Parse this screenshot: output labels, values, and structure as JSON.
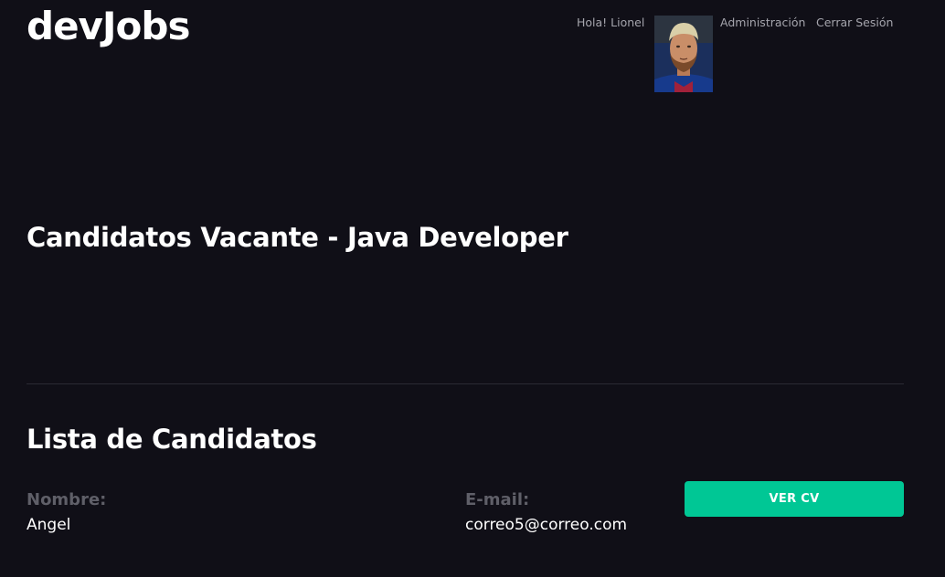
{
  "header": {
    "logo": "devJobs",
    "greeting": "Hola! Lionel",
    "admin_link": "Administración",
    "logout_link": "Cerrar Sesión"
  },
  "page": {
    "title": "Candidatos Vacante - Java Developer"
  },
  "candidates_section": {
    "title": "Lista de Candidatos",
    "name_label": "Nombre:",
    "email_label": "E-mail:",
    "items": [
      {
        "name": "Angel",
        "email": "correo5@correo.com",
        "button_label": "VER CV"
      }
    ]
  },
  "colors": {
    "background": "#100f17",
    "accent": "#00c795",
    "muted_label": "#5f5f68",
    "nav_text": "#a5a5ad"
  }
}
